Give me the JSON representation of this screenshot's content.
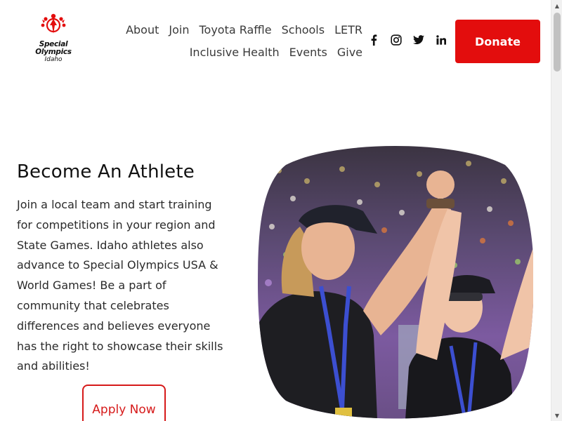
{
  "logo": {
    "line1": "Special",
    "line2": "Olympics",
    "line3": "Idaho",
    "color": "#e30d0d"
  },
  "nav": {
    "row1": [
      "About",
      "Join",
      "Toyota Raffle",
      "Schools",
      "LETR"
    ],
    "row2": [
      "Inclusive Health",
      "Events",
      "Give"
    ]
  },
  "social": [
    "facebook-icon",
    "instagram-icon",
    "twitter-icon",
    "linkedin-icon"
  ],
  "donate": {
    "label": "Donate",
    "color": "#e30d0d"
  },
  "hero": {
    "heading": "Become An Athlete",
    "body": "Join a local team and start training for competitions in your region and State Games. Idaho athletes also advance to Special Olympics USA & World Games! Be a part of community that celebrates differences and believes everyone has the right to showcase their skills and abilities!",
    "apply_label": "Apply Now",
    "accent": "#d61a1a"
  },
  "scrollbar": {
    "thumb_color": "#c1c1c1"
  }
}
